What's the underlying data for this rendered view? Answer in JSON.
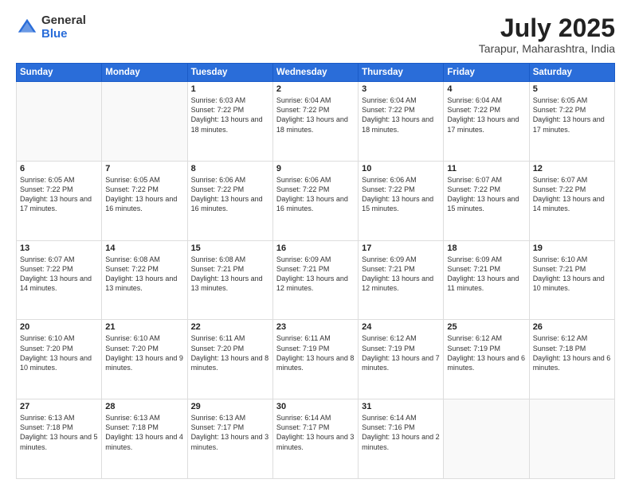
{
  "logo": {
    "general": "General",
    "blue": "Blue"
  },
  "header": {
    "month": "July 2025",
    "location": "Tarapur, Maharashtra, India"
  },
  "weekdays": [
    "Sunday",
    "Monday",
    "Tuesday",
    "Wednesday",
    "Thursday",
    "Friday",
    "Saturday"
  ],
  "weeks": [
    [
      {
        "day": "",
        "sunrise": "",
        "sunset": "",
        "daylight": ""
      },
      {
        "day": "",
        "sunrise": "",
        "sunset": "",
        "daylight": ""
      },
      {
        "day": "1",
        "sunrise": "Sunrise: 6:03 AM",
        "sunset": "Sunset: 7:22 PM",
        "daylight": "Daylight: 13 hours and 18 minutes."
      },
      {
        "day": "2",
        "sunrise": "Sunrise: 6:04 AM",
        "sunset": "Sunset: 7:22 PM",
        "daylight": "Daylight: 13 hours and 18 minutes."
      },
      {
        "day": "3",
        "sunrise": "Sunrise: 6:04 AM",
        "sunset": "Sunset: 7:22 PM",
        "daylight": "Daylight: 13 hours and 18 minutes."
      },
      {
        "day": "4",
        "sunrise": "Sunrise: 6:04 AM",
        "sunset": "Sunset: 7:22 PM",
        "daylight": "Daylight: 13 hours and 17 minutes."
      },
      {
        "day": "5",
        "sunrise": "Sunrise: 6:05 AM",
        "sunset": "Sunset: 7:22 PM",
        "daylight": "Daylight: 13 hours and 17 minutes."
      }
    ],
    [
      {
        "day": "6",
        "sunrise": "Sunrise: 6:05 AM",
        "sunset": "Sunset: 7:22 PM",
        "daylight": "Daylight: 13 hours and 17 minutes."
      },
      {
        "day": "7",
        "sunrise": "Sunrise: 6:05 AM",
        "sunset": "Sunset: 7:22 PM",
        "daylight": "Daylight: 13 hours and 16 minutes."
      },
      {
        "day": "8",
        "sunrise": "Sunrise: 6:06 AM",
        "sunset": "Sunset: 7:22 PM",
        "daylight": "Daylight: 13 hours and 16 minutes."
      },
      {
        "day": "9",
        "sunrise": "Sunrise: 6:06 AM",
        "sunset": "Sunset: 7:22 PM",
        "daylight": "Daylight: 13 hours and 16 minutes."
      },
      {
        "day": "10",
        "sunrise": "Sunrise: 6:06 AM",
        "sunset": "Sunset: 7:22 PM",
        "daylight": "Daylight: 13 hours and 15 minutes."
      },
      {
        "day": "11",
        "sunrise": "Sunrise: 6:07 AM",
        "sunset": "Sunset: 7:22 PM",
        "daylight": "Daylight: 13 hours and 15 minutes."
      },
      {
        "day": "12",
        "sunrise": "Sunrise: 6:07 AM",
        "sunset": "Sunset: 7:22 PM",
        "daylight": "Daylight: 13 hours and 14 minutes."
      }
    ],
    [
      {
        "day": "13",
        "sunrise": "Sunrise: 6:07 AM",
        "sunset": "Sunset: 7:22 PM",
        "daylight": "Daylight: 13 hours and 14 minutes."
      },
      {
        "day": "14",
        "sunrise": "Sunrise: 6:08 AM",
        "sunset": "Sunset: 7:22 PM",
        "daylight": "Daylight: 13 hours and 13 minutes."
      },
      {
        "day": "15",
        "sunrise": "Sunrise: 6:08 AM",
        "sunset": "Sunset: 7:21 PM",
        "daylight": "Daylight: 13 hours and 13 minutes."
      },
      {
        "day": "16",
        "sunrise": "Sunrise: 6:09 AM",
        "sunset": "Sunset: 7:21 PM",
        "daylight": "Daylight: 13 hours and 12 minutes."
      },
      {
        "day": "17",
        "sunrise": "Sunrise: 6:09 AM",
        "sunset": "Sunset: 7:21 PM",
        "daylight": "Daylight: 13 hours and 12 minutes."
      },
      {
        "day": "18",
        "sunrise": "Sunrise: 6:09 AM",
        "sunset": "Sunset: 7:21 PM",
        "daylight": "Daylight: 13 hours and 11 minutes."
      },
      {
        "day": "19",
        "sunrise": "Sunrise: 6:10 AM",
        "sunset": "Sunset: 7:21 PM",
        "daylight": "Daylight: 13 hours and 10 minutes."
      }
    ],
    [
      {
        "day": "20",
        "sunrise": "Sunrise: 6:10 AM",
        "sunset": "Sunset: 7:20 PM",
        "daylight": "Daylight: 13 hours and 10 minutes."
      },
      {
        "day": "21",
        "sunrise": "Sunrise: 6:10 AM",
        "sunset": "Sunset: 7:20 PM",
        "daylight": "Daylight: 13 hours and 9 minutes."
      },
      {
        "day": "22",
        "sunrise": "Sunrise: 6:11 AM",
        "sunset": "Sunset: 7:20 PM",
        "daylight": "Daylight: 13 hours and 8 minutes."
      },
      {
        "day": "23",
        "sunrise": "Sunrise: 6:11 AM",
        "sunset": "Sunset: 7:19 PM",
        "daylight": "Daylight: 13 hours and 8 minutes."
      },
      {
        "day": "24",
        "sunrise": "Sunrise: 6:12 AM",
        "sunset": "Sunset: 7:19 PM",
        "daylight": "Daylight: 13 hours and 7 minutes."
      },
      {
        "day": "25",
        "sunrise": "Sunrise: 6:12 AM",
        "sunset": "Sunset: 7:19 PM",
        "daylight": "Daylight: 13 hours and 6 minutes."
      },
      {
        "day": "26",
        "sunrise": "Sunrise: 6:12 AM",
        "sunset": "Sunset: 7:18 PM",
        "daylight": "Daylight: 13 hours and 6 minutes."
      }
    ],
    [
      {
        "day": "27",
        "sunrise": "Sunrise: 6:13 AM",
        "sunset": "Sunset: 7:18 PM",
        "daylight": "Daylight: 13 hours and 5 minutes."
      },
      {
        "day": "28",
        "sunrise": "Sunrise: 6:13 AM",
        "sunset": "Sunset: 7:18 PM",
        "daylight": "Daylight: 13 hours and 4 minutes."
      },
      {
        "day": "29",
        "sunrise": "Sunrise: 6:13 AM",
        "sunset": "Sunset: 7:17 PM",
        "daylight": "Daylight: 13 hours and 3 minutes."
      },
      {
        "day": "30",
        "sunrise": "Sunrise: 6:14 AM",
        "sunset": "Sunset: 7:17 PM",
        "daylight": "Daylight: 13 hours and 3 minutes."
      },
      {
        "day": "31",
        "sunrise": "Sunrise: 6:14 AM",
        "sunset": "Sunset: 7:16 PM",
        "daylight": "Daylight: 13 hours and 2 minutes."
      },
      {
        "day": "",
        "sunrise": "",
        "sunset": "",
        "daylight": ""
      },
      {
        "day": "",
        "sunrise": "",
        "sunset": "",
        "daylight": ""
      }
    ]
  ]
}
